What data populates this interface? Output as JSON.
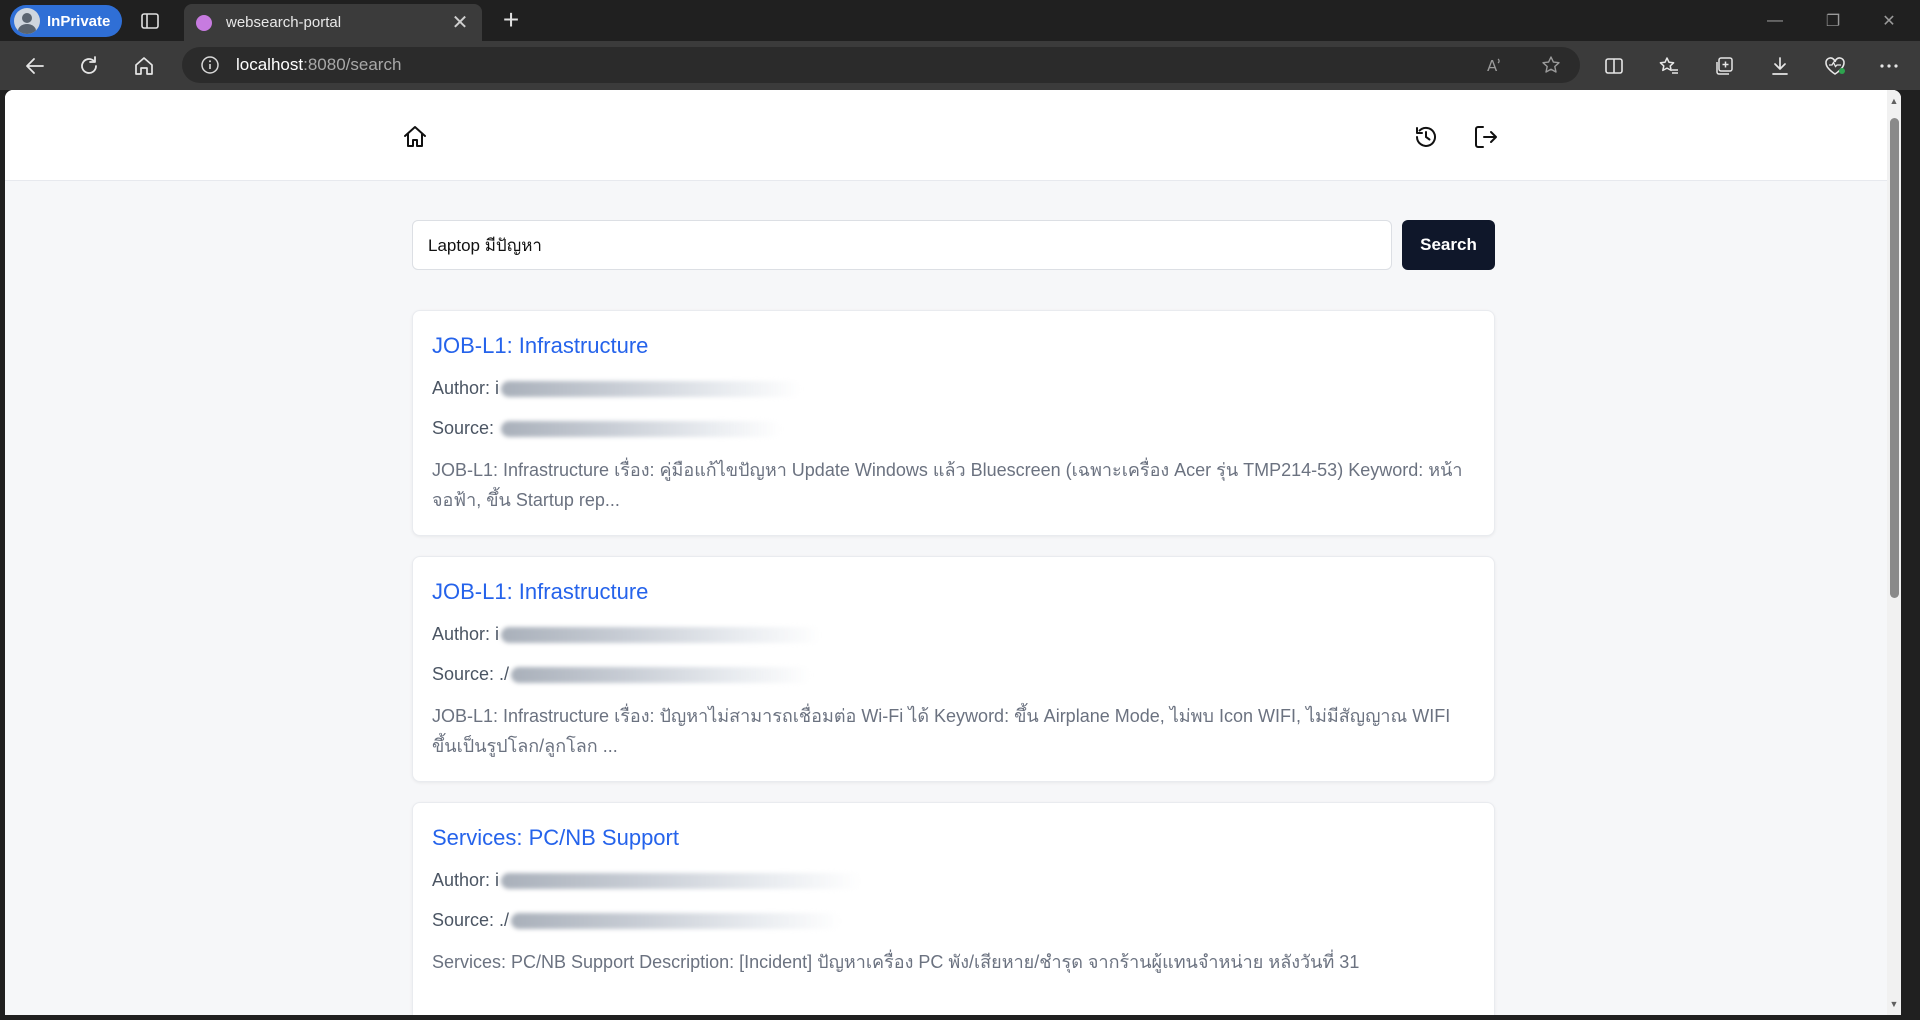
{
  "browser": {
    "profile_label": "InPrivate",
    "tab_title": "websearch-portal",
    "address_host": "localhost",
    "address_path": ":8080/search"
  },
  "search": {
    "query": "Laptop มีปัญหา",
    "button_label": "Search"
  },
  "results": [
    {
      "title": "JOB-L1: Infrastructure",
      "author_label": "Author: i",
      "source_label": "Source: ",
      "snippet": "JOB-L1: Infrastructure เรื่อง: คู่มือแก้ไขปัญหา Update Windows แล้ว Bluescreen (เฉพาะเครื่อง Acer รุ่น TMP214-53) Keyword: หน้าจอฟ้า, ขึ้น Startup rep..."
    },
    {
      "title": "JOB-L1: Infrastructure",
      "author_label": "Author: i",
      "source_label": "Source: ./",
      "snippet": "JOB-L1: Infrastructure เรื่อง: ปัญหาไม่สามารถเชื่อมต่อ Wi-Fi ได้ Keyword: ขึ้น Airplane Mode, ไม่พบ Icon WIFI, ไม่มีสัญญาณ WIFI ขึ้นเป็นรูปโลก/ลูกโลก ..."
    },
    {
      "title": "Services: PC/NB Support",
      "author_label": "Author: i",
      "source_label": "Source: ./",
      "snippet": "Services: PC/NB Support Description: [Incident] ปัญหาเครื่อง PC พัง/เสียหาย/ชำรุด จากร้านผู้แทนจำหน่าย หลังวันที่ 31"
    }
  ]
}
